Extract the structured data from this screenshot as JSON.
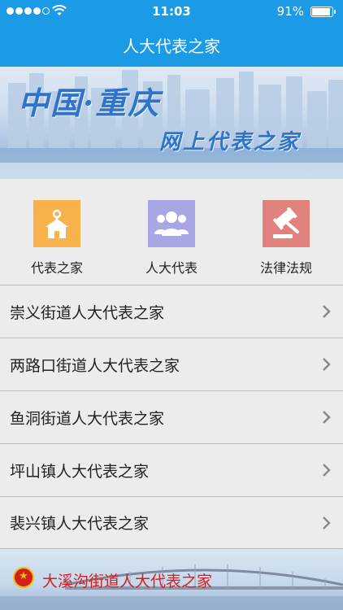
{
  "status_bar": {
    "time": "11:03",
    "battery_percent": "91%",
    "battery_level": 0.91
  },
  "nav": {
    "title": "人大代表之家"
  },
  "banner": {
    "line1": "中国·重庆",
    "line2": "网上代表之家"
  },
  "quick_icons": [
    {
      "label": "代表之家",
      "icon": "house-icon",
      "color": "#f7b24c"
    },
    {
      "label": "人大代表",
      "icon": "people-icon",
      "color": "#a9a6e6"
    },
    {
      "label": "法律法规",
      "icon": "gavel-icon",
      "color": "#e0837c"
    }
  ],
  "list": [
    {
      "label": "崇义街道人大代表之家"
    },
    {
      "label": "两路口街道人大代表之家"
    },
    {
      "label": "鱼洞街道人大代表之家"
    },
    {
      "label": "坪山镇人大代表之家"
    },
    {
      "label": "裴兴镇人大代表之家"
    }
  ],
  "bottom_banner": {
    "title": "大溪沟街道人大代表之家"
  },
  "colors": {
    "primary": "#1b9ae6",
    "bottom_title": "#d42020"
  }
}
